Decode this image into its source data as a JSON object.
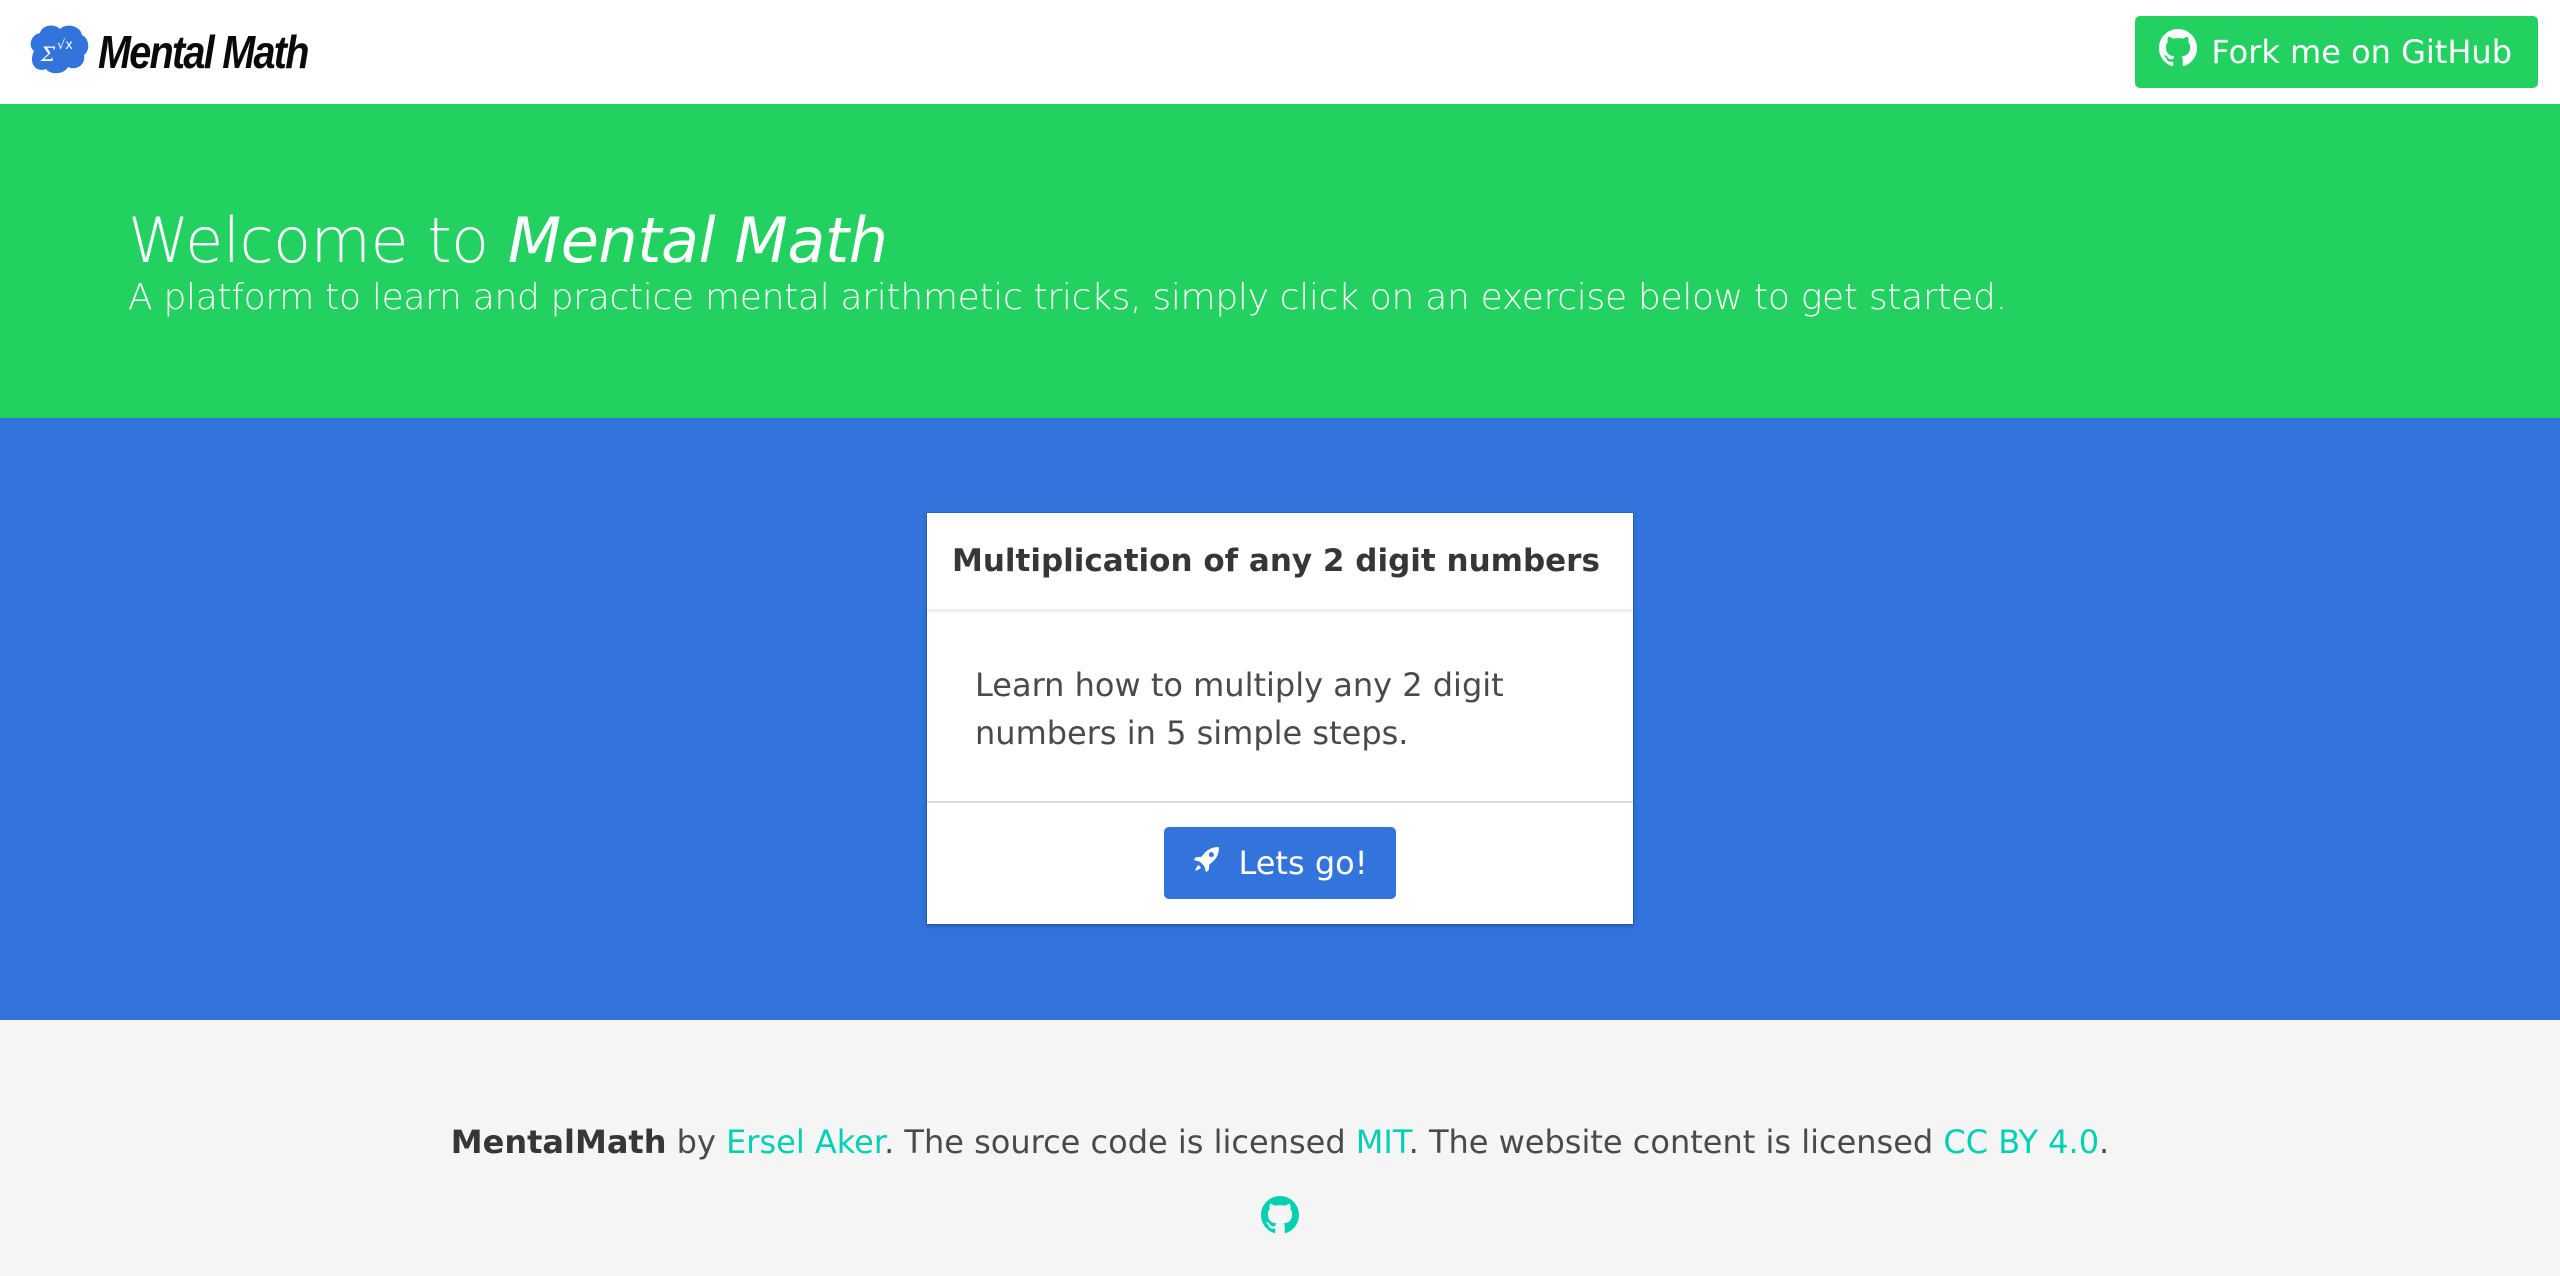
{
  "navbar": {
    "brand_name": "Mental Math",
    "github_button_label": "Fork me on GitHub",
    "logo_icon": "brain-math-icon",
    "github_icon": "github-icon"
  },
  "hero": {
    "title_prefix": "Welcome to ",
    "title_emphasis": "Mental Math",
    "subtitle": "A platform to learn and practice mental arithmetic tricks, simply click on an exercise below to get started."
  },
  "exercise_card": {
    "title": "Multiplication of any 2 digit numbers",
    "description_line1": "Learn how to multiply any 2 digit",
    "description_line2": "numbers in 5 simple steps.",
    "button_label": "Lets go!",
    "button_icon": "rocket-icon"
  },
  "footer": {
    "project_name": "MentalMath",
    "by_text": " by ",
    "author": "Ersel Aker",
    "source_text": ". The source code is licensed ",
    "source_license": "MIT",
    "content_text": ". The website content is licensed ",
    "content_license": "CC BY 4.0",
    "end_text": ".",
    "github_icon": "github-icon"
  },
  "colors": {
    "hero_green": "#23d160",
    "primary_blue": "#3273dc",
    "link_teal": "#00d1b2",
    "footer_bg": "#f5f5f5"
  }
}
